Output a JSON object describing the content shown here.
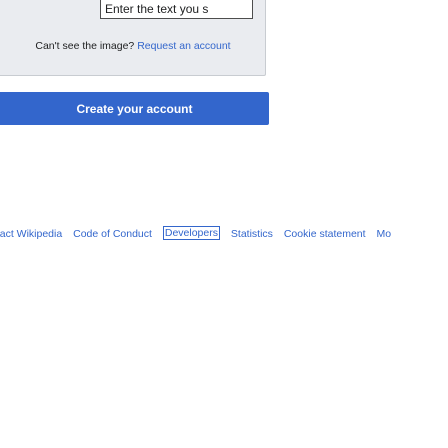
{
  "captcha": {
    "input_value": "",
    "input_placeholder": "Enter the text you s",
    "cant_see_text": "Can't see the image?",
    "request_link": "Request an account"
  },
  "form": {
    "submit_label": "Create your account"
  },
  "footer": {
    "links": [
      {
        "label": "ntact Wikipedia"
      },
      {
        "label": "Code of Conduct"
      },
      {
        "label": "Developers"
      },
      {
        "label": "Statistics"
      },
      {
        "label": "Cookie statement"
      },
      {
        "label": "Mo"
      }
    ]
  }
}
